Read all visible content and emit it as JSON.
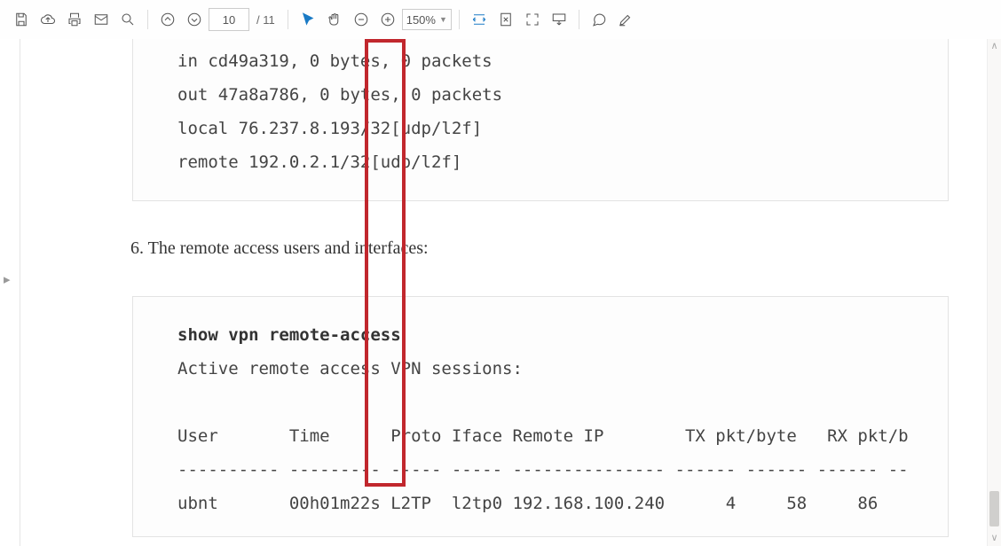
{
  "toolbar": {
    "page_current": "10",
    "page_total": "/ 11",
    "zoom": "150%"
  },
  "doc": {
    "code1_l1": "in cd49a319, 0 bytes, 0 packets",
    "code1_l2": "out 47a8a786, 0 bytes, 0 packets",
    "code1_l3": "local 76.237.8.193/32[udp/l2f]",
    "code1_l4": "remote 192.0.2.1/32[udp/l2f]",
    "para6": "6. The remote access users and interfaces:",
    "cmd2": "show vpn remote-access",
    "sess_hdr": "Active remote access VPN sessions:",
    "tbl_hdr": "User       Time      Proto Iface Remote IP        TX pkt/byte   RX pkt/b",
    "tbl_sep": "---------- --------- ----- ----- --------------- ------ ------ ------ --",
    "tbl_row": "ubnt       00h01m22s L2TP  l2tp0 192.168.100.240      4     58     86"
  }
}
